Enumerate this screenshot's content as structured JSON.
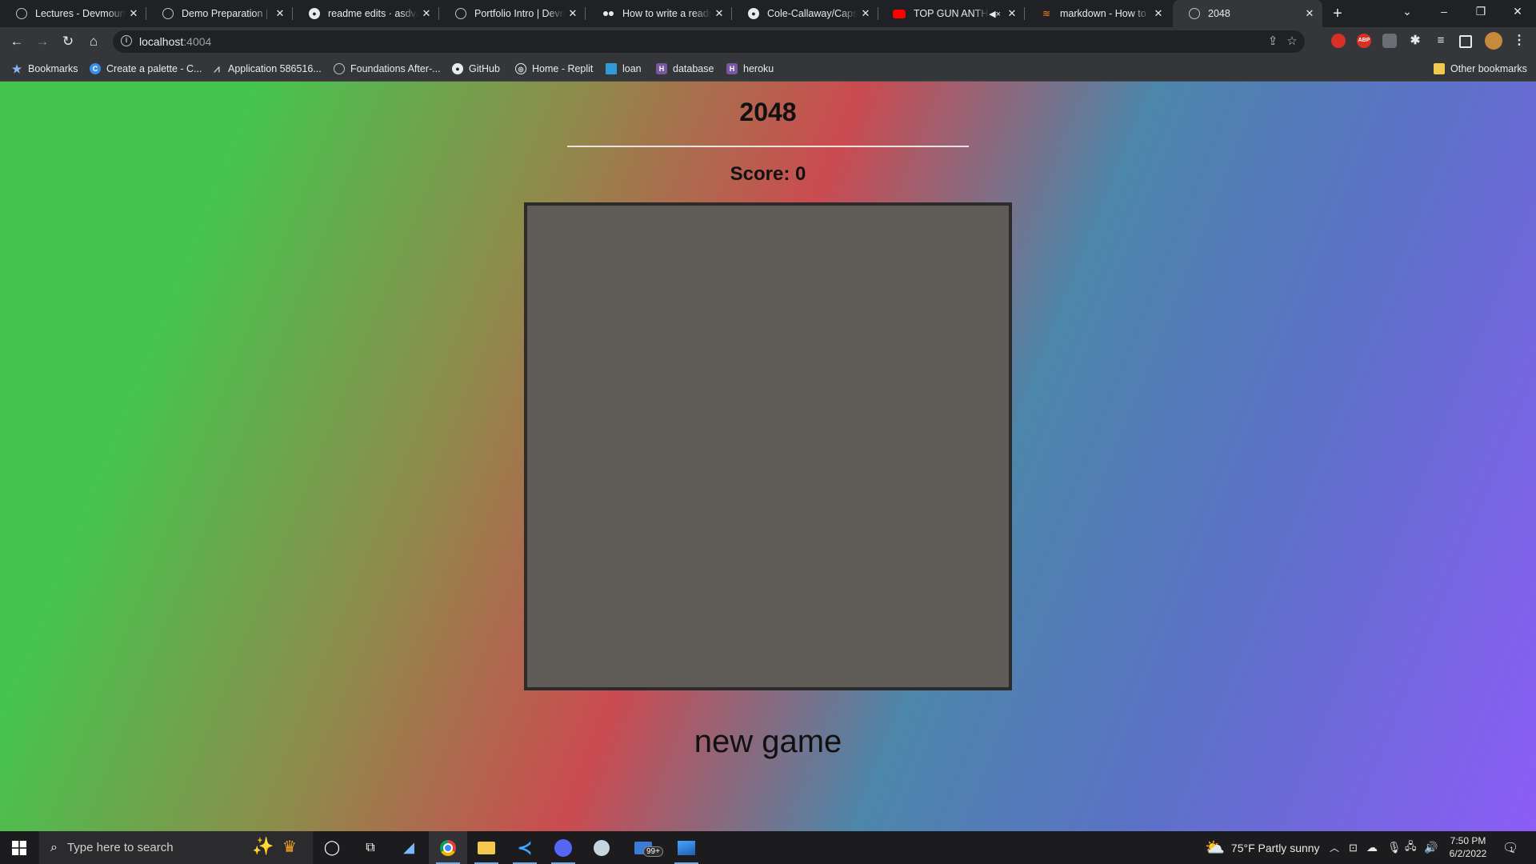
{
  "browser": {
    "tabs": [
      {
        "title": "Lectures - Devmountain",
        "favicon": "globe-icon"
      },
      {
        "title": "Demo Preparation | Devmountain",
        "favicon": "globe-icon"
      },
      {
        "title": "readme edits · asdvalenzuela",
        "favicon": "github-icon"
      },
      {
        "title": "Portfolio Intro | Devmountain",
        "favicon": "globe-icon"
      },
      {
        "title": "How to write a readme",
        "favicon": "medium-icon"
      },
      {
        "title": "Cole-Callaway/Capstone",
        "favicon": "github-icon"
      },
      {
        "title": "TOP GUN ANTHEM",
        "favicon": "youtube-icon"
      },
      {
        "title": "markdown - How to add",
        "favicon": "stackoverflow-icon"
      },
      {
        "title": "2048",
        "favicon": "globe-icon"
      }
    ],
    "url_host": "localhost",
    "url_port": ":4004",
    "bookmarks": [
      {
        "label": "Bookmarks"
      },
      {
        "label": "Create a palette - C..."
      },
      {
        "label": "Application 586516..."
      },
      {
        "label": "Foundations After-..."
      },
      {
        "label": "GitHub"
      },
      {
        "label": "Home - Replit"
      },
      {
        "label": "loan"
      },
      {
        "label": "database"
      },
      {
        "label": "heroku"
      }
    ],
    "other_bookmarks": "Other bookmarks",
    "extensions": {
      "abp": "ABP"
    }
  },
  "game": {
    "title": "2048",
    "score_label": "Score: 0",
    "new_game_label": "new game"
  },
  "taskbar": {
    "search_placeholder": "Type here to search",
    "weather": "75°F  Partly sunny",
    "time": "7:50 PM",
    "date": "6/2/2022",
    "mail_badge": "99+",
    "notification_count": "1"
  }
}
